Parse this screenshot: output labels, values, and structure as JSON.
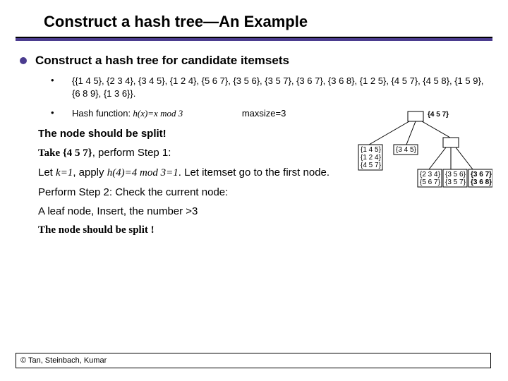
{
  "title": "Construct a hash tree—An Example",
  "heading": "Construct a hash tree for candidate itemsets",
  "itemsets": "{{1 4 5}, {2 3 4}, {3 4 5}, {1 2 4}, {5 6 7}, {3 5 6}, {3 5 7}, {3 6 7}, {3 6 8}, {1 2 5}, {4 5 7}, {4 5 8}, {1 5 9}, {6 8 9}, {1 3 6}}.",
  "hash_label": "Hash function:",
  "hash_fn": " h(x)=x mod 3",
  "maxsize": "maxsize=3",
  "line_split1": "The node should be split!",
  "take_prefix": "Take ",
  "take_set": "{4 5 7}",
  "take_suffix": ", perform Step 1:",
  "let_prefix": "Let ",
  "let_k": "k=1",
  "let_mid": ", apply ",
  "let_hash": "h(4)=4 mod 3=1",
  "let_suffix": ". Let itemset go to the first node.",
  "step2": "Perform  Step 2: Check the current node:",
  "leaf": "A leaf node, Insert, the number >3",
  "line_split2": "The node should be split !",
  "footer": "© Tan, Steinbach, Kumar",
  "tree": {
    "highlight": "{4 5 7}",
    "left_leaf": [
      "{1 4 5}",
      "{1 2 4}",
      "{4 5 7}"
    ],
    "mid_leaf": "{3 4 5}",
    "right_leaf1": [
      "{2 3 4}",
      "{5 6 7}"
    ],
    "right_leaf2": [
      "{3 5 6}",
      "{3 5 7}"
    ],
    "right_leaf3": [
      "{3 6 7}",
      "{3 6 8}"
    ]
  }
}
